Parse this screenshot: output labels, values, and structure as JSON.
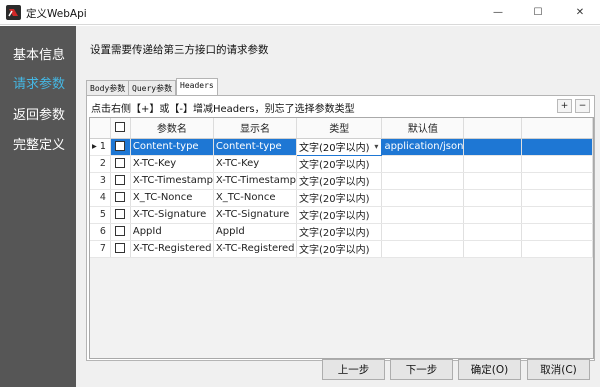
{
  "window": {
    "title": "定义WebApi",
    "min_glyph": "—",
    "max_glyph": "☐",
    "close_glyph": "✕"
  },
  "sidebar": {
    "items": [
      {
        "label": "基本信息",
        "active": false
      },
      {
        "label": "请求参数",
        "active": true
      },
      {
        "label": "返回参数",
        "active": false
      },
      {
        "label": "完整定义",
        "active": false
      }
    ]
  },
  "main": {
    "description": "设置需要传递给第三方接口的请求参数",
    "tabs": [
      {
        "label": "Body参数",
        "active": false
      },
      {
        "label": "Query参数",
        "active": false
      },
      {
        "label": "Headers",
        "active": true
      }
    ],
    "hint": "点击右侧【+】或【-】增减Headers，别忘了选择参数类型",
    "add_label": "+",
    "remove_label": "−"
  },
  "table": {
    "columns": [
      "",
      "",
      "参数名",
      "显示名",
      "类型",
      "默认值",
      "",
      ""
    ],
    "rows": [
      {
        "marker": "▸",
        "num": "1",
        "name": "Content-type",
        "display": "Content-type",
        "type": "文字(20字以内)",
        "default": "application/json"
      },
      {
        "marker": "",
        "num": "2",
        "name": "X-TC-Key",
        "display": "X-TC-Key",
        "type": "文字(20字以内)",
        "default": ""
      },
      {
        "marker": "",
        "num": "3",
        "name": "X-TC-Timestamp",
        "display": "X-TC-Timestamp",
        "type": "文字(20字以内)",
        "default": ""
      },
      {
        "marker": "",
        "num": "4",
        "name": "X_TC-Nonce",
        "display": "X_TC-Nonce",
        "type": "文字(20字以内)",
        "default": ""
      },
      {
        "marker": "",
        "num": "5",
        "name": "X-TC-Signature",
        "display": "X-TC-Signature",
        "type": "文字(20字以内)",
        "default": ""
      },
      {
        "marker": "",
        "num": "6",
        "name": "AppId",
        "display": "AppId",
        "type": "文字(20字以内)",
        "default": ""
      },
      {
        "marker": "",
        "num": "7",
        "name": "X-TC-Registered",
        "display": "X-TC-Registered",
        "type": "文字(20字以内)",
        "default": ""
      }
    ],
    "dropdown_arrow": "▾"
  },
  "footer": {
    "prev": "上一步",
    "next": "下一步",
    "ok": "确定(O)",
    "cancel": "取消(C)"
  },
  "colors": {
    "sidebar_bg": "#565656",
    "active_nav": "#45b7e3",
    "selection": "#1e77d4"
  }
}
